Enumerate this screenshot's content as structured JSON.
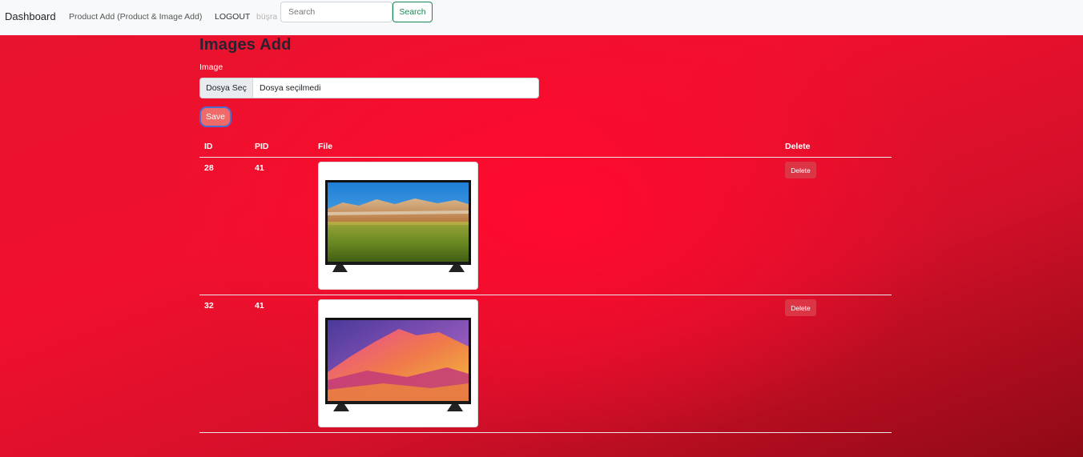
{
  "navbar": {
    "brand": "Dashboard",
    "links": {
      "product_add": "Product Add (Product & Image Add)",
      "logout": "LOGOUT"
    },
    "user": "büşra",
    "search": {
      "placeholder": "Search",
      "value": "",
      "button_label": "Search"
    }
  },
  "form": {
    "title": "Images Add",
    "image_label": "Image",
    "file_input": {
      "button_label": "Dosya Seç",
      "status": "Dosya seçilmedi"
    },
    "save_label": "Save"
  },
  "table": {
    "headers": {
      "id": "ID",
      "pid": "PID",
      "file": "File",
      "delete": "Delete"
    },
    "rows": [
      {
        "id": "28",
        "pid": "41",
        "file_image": "tv-landscape-image",
        "delete_label": "Delete"
      },
      {
        "id": "32",
        "pid": "41",
        "file_image": "tv-pink-mountain-image",
        "delete_label": "Delete"
      }
    ]
  },
  "colors": {
    "navbar_bg": "#f8f9fa",
    "page_bg": "#e8132e",
    "search_green": "#198754",
    "delete_red": "#dc3545",
    "save_bg": "#f06a6a"
  }
}
